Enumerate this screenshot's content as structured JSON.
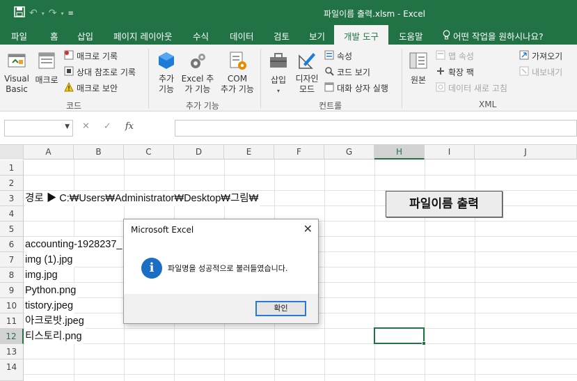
{
  "window": {
    "title": "파일이름 출력.xlsm  -  Excel"
  },
  "qat": {
    "save_icon": "save-icon",
    "undo_icon": "undo-icon",
    "redo_icon": "redo-icon",
    "custom_icon": "quick-access-customize-icon"
  },
  "tabs": [
    {
      "label": "파일"
    },
    {
      "label": "홈"
    },
    {
      "label": "삽입"
    },
    {
      "label": "페이지 레이아웃"
    },
    {
      "label": "수식"
    },
    {
      "label": "데이터"
    },
    {
      "label": "검토"
    },
    {
      "label": "보기"
    },
    {
      "label": "개발 도구",
      "active": true
    },
    {
      "label": "도움말"
    }
  ],
  "tell_me": "어떤 작업을 원하시나요?",
  "ribbon": {
    "code": {
      "label": "코드",
      "visual_basic": "Visual\nBasic",
      "macro": "매크로",
      "record_macro": "매크로 기록",
      "relative_ref": "상대 참조로 기록",
      "macro_security": "매크로 보안"
    },
    "addins": {
      "label": "추가 기능",
      "addins": "추가\n기능",
      "excel_addins": "Excel 추\n가 기능",
      "com_addins": "COM\n추가 기능"
    },
    "controls": {
      "label": "컨트롤",
      "insert": "삽입",
      "design_mode": "디자인\n모드",
      "properties": "속성",
      "view_code": "코드 보기",
      "run_dialog": "대화 상자 실행"
    },
    "xml": {
      "label": "XML",
      "source": "원본",
      "map_properties": "맵 속성",
      "expansion_packs": "확장 팩",
      "refresh_data": "데이터 새로 고침",
      "import": "가져오기",
      "export": "내보내기"
    }
  },
  "formula_bar": {
    "name_box": "",
    "cancel": "✕",
    "enter": "✓",
    "fx": "fx",
    "value": ""
  },
  "columns": [
    "A",
    "B",
    "C",
    "D",
    "E",
    "F",
    "G",
    "H",
    "I",
    "J"
  ],
  "selected_column": "H",
  "rows": [
    "1",
    "2",
    "3",
    "4",
    "5",
    "6",
    "7",
    "8",
    "9",
    "10",
    "11",
    "12",
    "13",
    "14"
  ],
  "selected_row": "12",
  "cells": {
    "a3": "경로 ▶ C:₩Users₩Administrator₩Desktop₩그림₩",
    "a6": "accounting-1928237_",
    "a7": "img (1).jpg",
    "a8": "img.jpg",
    "a9": "Python.png",
    "a10": "tistory.jpeg",
    "a11": "아크로밧.jpeg",
    "a12": "티스토리.png"
  },
  "sheet_button": {
    "label": "파일이름 출력"
  },
  "dialog": {
    "title": "Microsoft Excel",
    "close": "✕",
    "icon": "i",
    "message": "파일명을 성공적으로 불러들였습니다.",
    "ok": "확인"
  },
  "colors": {
    "accent": "#217346",
    "info_icon": "#1b6ec2"
  }
}
